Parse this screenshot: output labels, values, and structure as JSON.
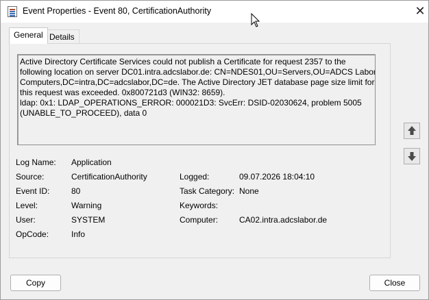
{
  "window": {
    "title": "Event Properties - Event 80, CertificationAuthority",
    "close_glyph": "✕"
  },
  "tabs": [
    {
      "label": "General",
      "active": true
    },
    {
      "label": "Details",
      "active": false
    }
  ],
  "description": {
    "lines": [
      "Active Directory Certificate Services could not publish a Certificate for request 2357 to the",
      "following location on server DC01.intra.adcslabor.de: CN=NDES01,OU=Servers,OU=ADCS Labor",
      "Computers,DC=intra,DC=adcslabor,DC=de.  The Active Directory JET database page size limit for",
      "this request was exceeded. 0x800721d3 (WIN32: 8659).",
      "ldap: 0x1: LDAP_OPERATIONS_ERROR: 000021D3: SvcErr: DSID-02030624, problem 5005",
      "(UNABLE_TO_PROCEED), data 0"
    ]
  },
  "fields": {
    "log_name": {
      "label": "Log Name:",
      "value": "Application"
    },
    "source": {
      "label": "Source:",
      "value": "CertificationAuthority"
    },
    "event_id": {
      "label": "Event ID:",
      "value": "80"
    },
    "level": {
      "label": "Level:",
      "value": "Warning"
    },
    "user": {
      "label": "User:",
      "value": "SYSTEM"
    },
    "opcode": {
      "label": "OpCode:",
      "value": "Info"
    },
    "logged": {
      "label": "Logged:",
      "value": "09.07.2026 18:04:10"
    },
    "task_category": {
      "label": "Task Category:",
      "value": "None"
    },
    "keywords": {
      "label": "Keywords:",
      "value": ""
    },
    "computer": {
      "label": "Computer:",
      "value": "CA02.intra.adcslabor.de"
    }
  },
  "buttons": {
    "copy": "Copy",
    "close": "Close"
  },
  "icons": {
    "app": "event-viewer-icon",
    "up": "arrow-up-icon",
    "down": "arrow-down-icon",
    "cursor": "mouse-pointer-icon"
  }
}
